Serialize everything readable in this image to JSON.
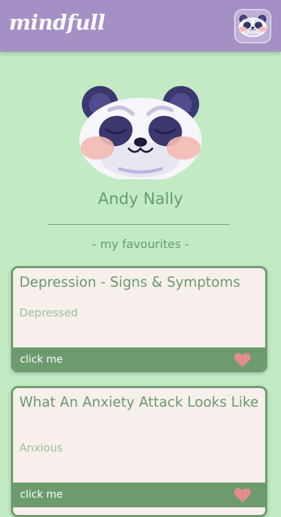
{
  "header": {
    "brand": "mindfull",
    "avatar_icon": "panda-avatar-icon",
    "background": "#a590c6"
  },
  "profile": {
    "avatar_icon": "panda-face-icon",
    "name": "Andy Nally"
  },
  "favourites": {
    "heading": "- my favourites -",
    "items": [
      {
        "title": "Depression - Signs & Symptoms",
        "tag": "Depressed",
        "action": "click me",
        "icon": "heart-icon"
      },
      {
        "title": "What An Anxiety Attack Looks Like",
        "tag": "Anxious",
        "action": "click me",
        "icon": "heart-icon"
      }
    ]
  },
  "colors": {
    "background": "#c2eac5",
    "accent_green": "#6d9b6e",
    "card_bg": "#f7efec",
    "heart": "#e28d8a"
  }
}
